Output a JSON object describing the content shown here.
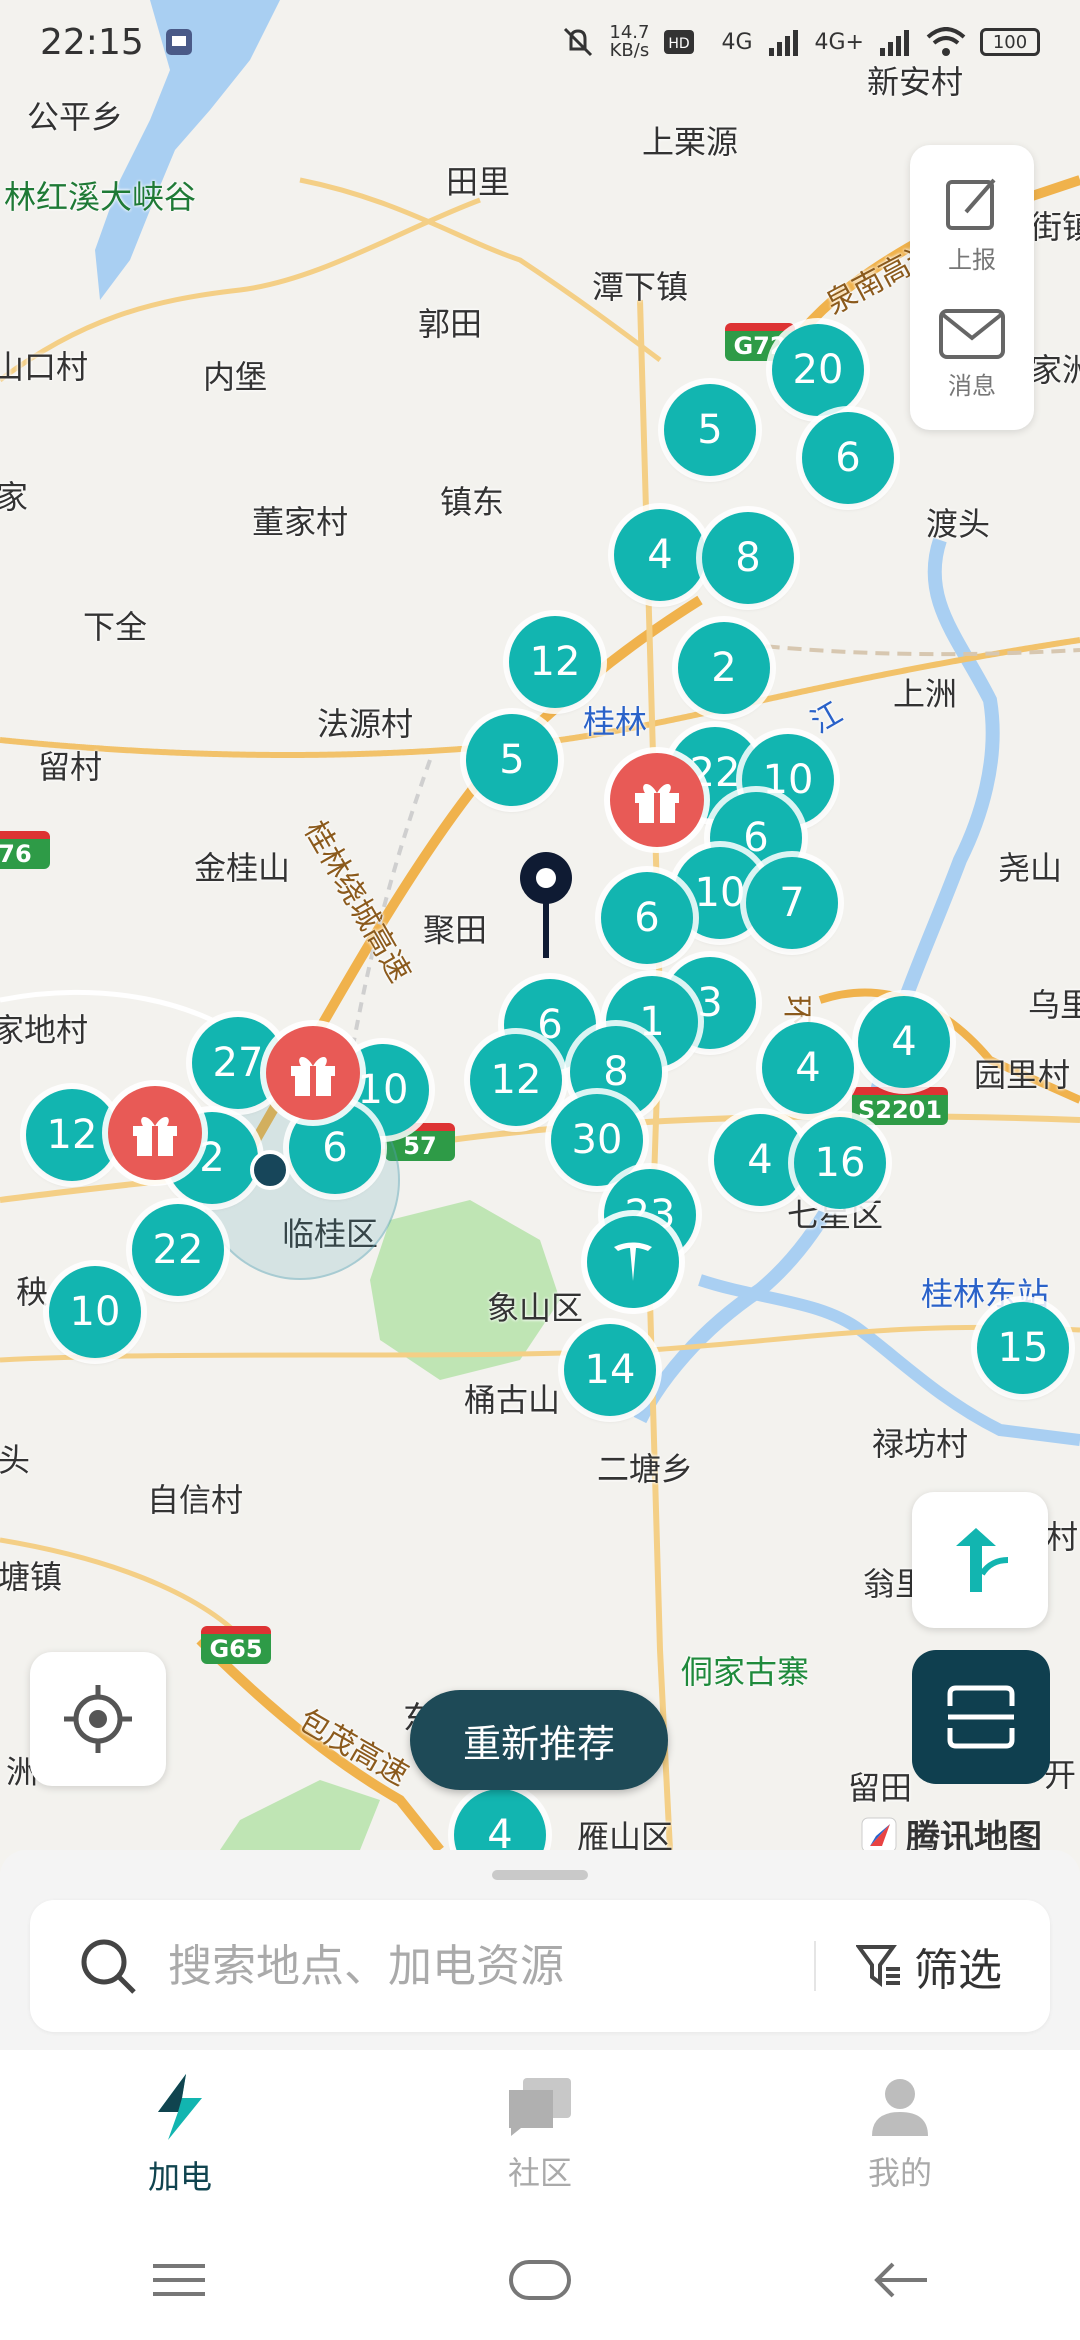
{
  "status": {
    "time": "22:15",
    "net_speed": "14.7\nKB/s",
    "signal1": "4G",
    "signal2": "4G+",
    "battery": "100"
  },
  "places": {
    "gongping": "公平乡",
    "shangliyuan": "上栗源",
    "xinancun": "新安村",
    "tianli": "田里",
    "hongxi": "林红溪大峡谷",
    "tanxia": "潭下镇",
    "guotian": "郭田",
    "neibao": "内堡",
    "koucun": "山口村",
    "jia1": "家",
    "jiaz": "家洲",
    "dongjia": "董家村",
    "zhendong": "镇东",
    "dutou": "渡头",
    "xiaquan": "下全",
    "fayuan": "法源村",
    "guilin": "桂林",
    "liucun": "留村",
    "shangzhou": "上洲",
    "jingui": "金桂山",
    "jutian": "聚田",
    "yaoshan": "尧山",
    "wuli": "乌里",
    "jiadi": "家地村",
    "yuanli": "园里村",
    "lingui": "临桂区",
    "qixing": "七星区",
    "guilineast": "桂林东站",
    "qin": "秧",
    "xiangshan": "象山区",
    "tonggu": "桶古山",
    "ertang": "二塘乡",
    "lufang": "禄坊村",
    "tou": "头",
    "zixin": "自信村",
    "tangzhen": "塘镇",
    "wengcun": "翁里",
    "dongjia2": "侗家古寨",
    "dongcun": "东村",
    "zhou": "洲",
    "liutian": "留田",
    "yanshan": "雁山区",
    "kai": "开",
    "cun": "村",
    "jiezhen": "街镇"
  },
  "roads": {
    "quannan": "泉南高速",
    "guilinrao": "桂林绕城高速",
    "baomao": "包茂高速",
    "huan": "环",
    "jiang": "江"
  },
  "shields": {
    "g72": "G72",
    "s76": "76",
    "s57": "57",
    "s2201": "S2201",
    "g65": "G65"
  },
  "clusters": [
    "20",
    "5",
    "6",
    "4",
    "8",
    "12",
    "2",
    "5",
    "22",
    "10",
    "6",
    "10",
    "7",
    "6",
    "6",
    "3",
    "1",
    "12",
    "8",
    "27",
    "10",
    "12",
    "2",
    "6",
    "22",
    "10",
    "30",
    "4",
    "4",
    "4",
    "16",
    "23",
    "14",
    "15",
    "4"
  ],
  "side_panel": {
    "report": "上报",
    "message": "消息"
  },
  "recommend_label": "重新推荐",
  "map_credit": "腾讯地图",
  "search": {
    "placeholder": "搜索地点、加电资源",
    "filter_label": "筛选"
  },
  "tabs": [
    {
      "label": "加电"
    },
    {
      "label": "社区"
    },
    {
      "label": "我的"
    }
  ],
  "colors": {
    "cluster": "#12b5b0",
    "gift": "#e85a56",
    "dark": "#0f3f4f"
  }
}
